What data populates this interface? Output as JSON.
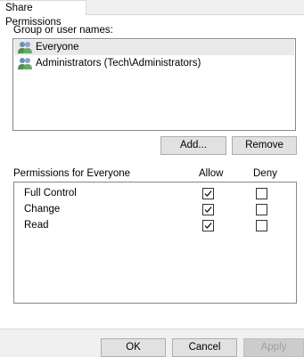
{
  "tab": {
    "label": "Share Permissions"
  },
  "users": {
    "label": "Group or user names:",
    "items": [
      {
        "name": "Everyone",
        "selected": true,
        "icon": "users-icon"
      },
      {
        "name": "Administrators (Tech\\Administrators)",
        "selected": false,
        "icon": "users-icon"
      }
    ],
    "add_label": "Add...",
    "remove_label": "Remove"
  },
  "permissions": {
    "label": "Permissions for Everyone",
    "allow_header": "Allow",
    "deny_header": "Deny",
    "rows": [
      {
        "name": "Full Control",
        "allow": true,
        "deny": false
      },
      {
        "name": "Change",
        "allow": true,
        "deny": false
      },
      {
        "name": "Read",
        "allow": true,
        "deny": false
      }
    ]
  },
  "footer": {
    "ok_label": "OK",
    "cancel_label": "Cancel",
    "apply_label": "Apply"
  }
}
